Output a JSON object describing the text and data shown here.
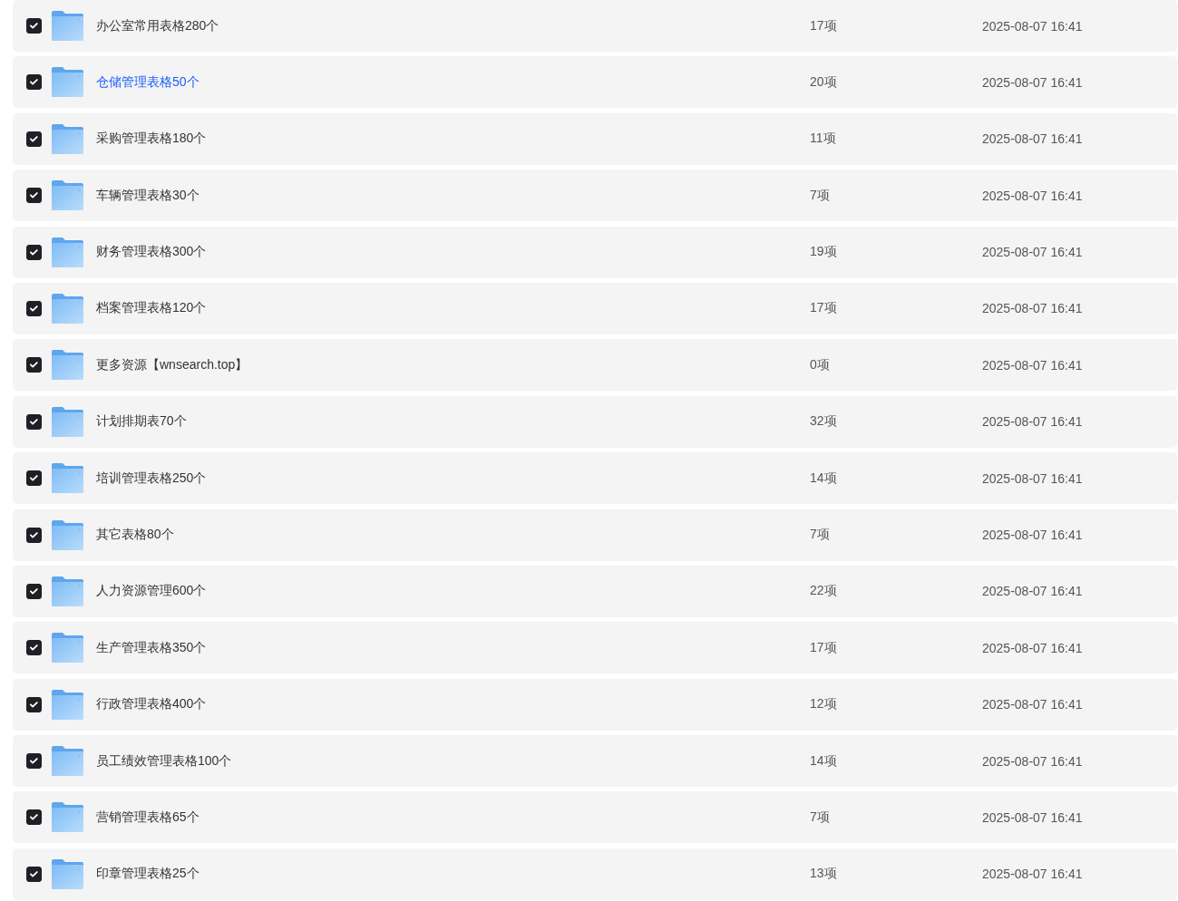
{
  "files": [
    {
      "name": "办公室常用表格280个",
      "count": "17项",
      "modified": "2025-08-07 16:41",
      "checked": true,
      "highlighted": false
    },
    {
      "name": "仓储管理表格50个",
      "count": "20项",
      "modified": "2025-08-07 16:41",
      "checked": true,
      "highlighted": true
    },
    {
      "name": "采购管理表格180个",
      "count": "11项",
      "modified": "2025-08-07 16:41",
      "checked": true,
      "highlighted": false
    },
    {
      "name": "车辆管理表格30个",
      "count": "7项",
      "modified": "2025-08-07 16:41",
      "checked": true,
      "highlighted": false
    },
    {
      "name": "财务管理表格300个",
      "count": "19项",
      "modified": "2025-08-07 16:41",
      "checked": true,
      "highlighted": false
    },
    {
      "name": "档案管理表格120个",
      "count": "17项",
      "modified": "2025-08-07 16:41",
      "checked": true,
      "highlighted": false
    },
    {
      "name": "更多资源【wnsearch.top】",
      "count": "0项",
      "modified": "2025-08-07 16:41",
      "checked": true,
      "highlighted": false
    },
    {
      "name": "计划排期表70个",
      "count": "32项",
      "modified": "2025-08-07 16:41",
      "checked": true,
      "highlighted": false
    },
    {
      "name": "培训管理表格250个",
      "count": "14项",
      "modified": "2025-08-07 16:41",
      "checked": true,
      "highlighted": false
    },
    {
      "name": "其它表格80个",
      "count": "7项",
      "modified": "2025-08-07 16:41",
      "checked": true,
      "highlighted": false
    },
    {
      "name": "人力资源管理600个",
      "count": "22项",
      "modified": "2025-08-07 16:41",
      "checked": true,
      "highlighted": false
    },
    {
      "name": "生产管理表格350个",
      "count": "17项",
      "modified": "2025-08-07 16:41",
      "checked": true,
      "highlighted": false
    },
    {
      "name": "行政管理表格400个",
      "count": "12项",
      "modified": "2025-08-07 16:41",
      "checked": true,
      "highlighted": false
    },
    {
      "name": "员工绩效管理表格100个",
      "count": "14项",
      "modified": "2025-08-07 16:41",
      "checked": true,
      "highlighted": false
    },
    {
      "name": "营销管理表格65个",
      "count": "7项",
      "modified": "2025-08-07 16:41",
      "checked": true,
      "highlighted": false
    },
    {
      "name": "印章管理表格25个",
      "count": "13项",
      "modified": "2025-08-07 16:41",
      "checked": true,
      "highlighted": false
    }
  ]
}
